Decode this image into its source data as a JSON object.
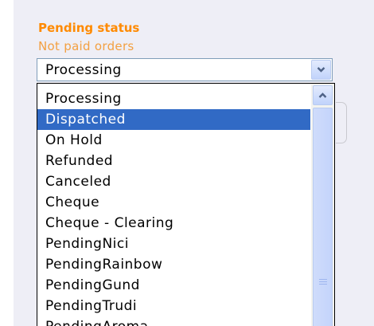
{
  "field": {
    "title": "Pending status",
    "subtitle": "Not paid orders",
    "selected_value": "Processing"
  },
  "dropdown": {
    "options": [
      {
        "label": "Processing",
        "selected": false
      },
      {
        "label": "Dispatched",
        "selected": true
      },
      {
        "label": "On Hold",
        "selected": false
      },
      {
        "label": "Refunded",
        "selected": false
      },
      {
        "label": "Canceled",
        "selected": false
      },
      {
        "label": "Cheque",
        "selected": false
      },
      {
        "label": "Cheque - Clearing",
        "selected": false
      },
      {
        "label": "PendingNici",
        "selected": false
      },
      {
        "label": "PendingRainbow",
        "selected": false
      },
      {
        "label": "PendingGund",
        "selected": false
      },
      {
        "label": "PendingTrudi",
        "selected": false
      },
      {
        "label": "PendingAroma",
        "selected": false
      }
    ],
    "highlight_color": "#316ac5"
  },
  "icons": {
    "select_arrow": "chevron-down-icon",
    "scroll_up": "chevron-up-icon"
  },
  "colors": {
    "title": "#ff8a00",
    "subtitle": "#f3a042",
    "panel_background": "#eeeef6"
  }
}
